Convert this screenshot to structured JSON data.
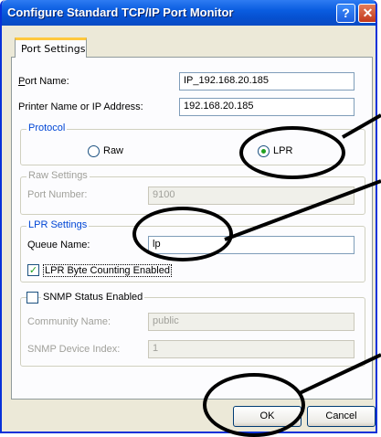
{
  "window": {
    "title": "Configure Standard TCP/IP Port Monitor",
    "help_glyph": "?",
    "close_glyph": "✕"
  },
  "tabs": [
    {
      "label": "Port Settings",
      "active": true
    }
  ],
  "port_name": {
    "label": "Port Name:",
    "value": "IP_192.168.20.185"
  },
  "printer_address": {
    "label": "Printer Name or IP Address:",
    "value": "192.168.20.185"
  },
  "protocol": {
    "legend": "Protocol",
    "options": [
      {
        "label": "Raw",
        "selected": false
      },
      {
        "label": "LPR",
        "selected": true
      }
    ]
  },
  "raw_settings": {
    "legend": "Raw Settings",
    "port_number_label": "Port Number:",
    "port_number_value": "9100"
  },
  "lpr_settings": {
    "legend": "LPR Settings",
    "queue_name_label": "Queue Name:",
    "queue_name_value": "lp",
    "byte_counting_label": "LPR Byte Counting Enabled",
    "byte_counting_checked": true
  },
  "snmp": {
    "status_label": "SNMP Status Enabled",
    "status_checked": false,
    "community_label": "Community Name:",
    "community_value": "public",
    "device_index_label": "SNMP Device Index:",
    "device_index_value": "1"
  },
  "buttons": {
    "ok": "OK",
    "cancel": "Cancel"
  },
  "colors": {
    "titlebar": "#0A5DE0",
    "group_legend": "#0046D5",
    "dialog_bg": "#ECE9D8",
    "check_mark": "#21A121"
  }
}
